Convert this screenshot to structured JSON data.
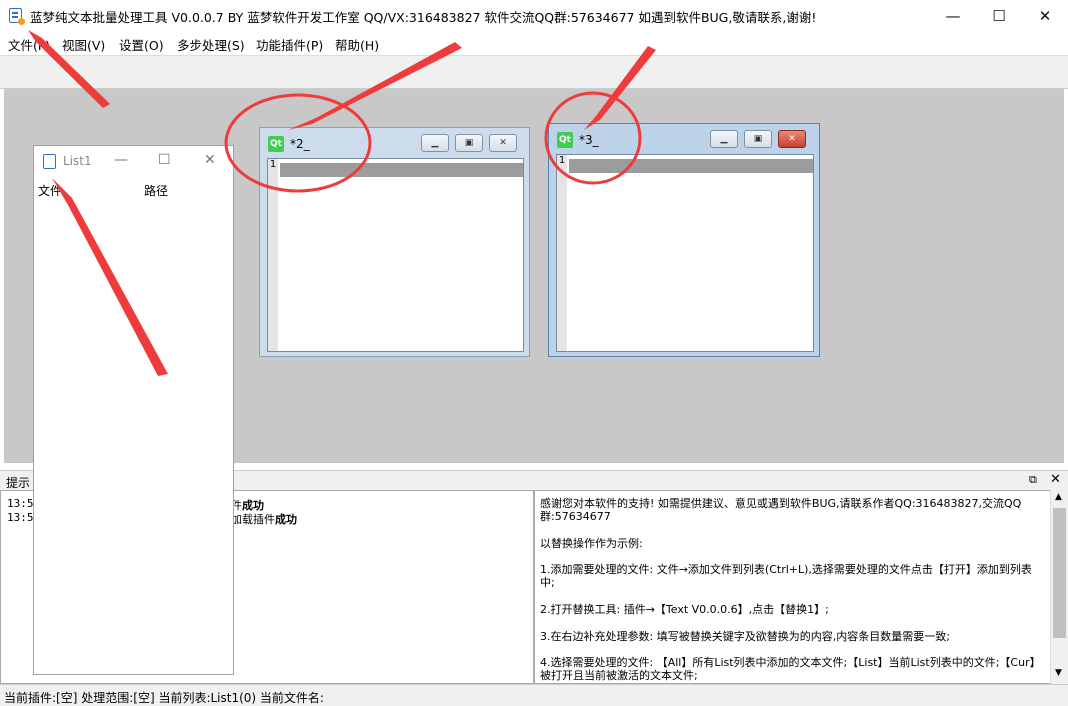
{
  "window": {
    "title": "蓝梦纯文本批量处理工具 V0.0.0.7 BY 蓝梦软件开发工作室 QQ/VX:316483827 软件交流QQ群:57634677 如遇到软件BUG,敬请联系,谢谢!",
    "minimize": "—",
    "maximize": "☐",
    "close": "✕"
  },
  "menu": {
    "file": "文件(F)",
    "view": "视图(V)",
    "settings": "设置(O)",
    "multistep": "多步处理(S)",
    "plugins": "功能插件(P)",
    "help": "帮助(H)"
  },
  "subwindows": [
    {
      "title": "*2_",
      "line": "1"
    },
    {
      "title": "*3_",
      "line": "1"
    }
  ],
  "list_window": {
    "title": "List1",
    "col_file": "文件",
    "col_path": "路径",
    "min": "—",
    "max": "☐",
    "close": "✕"
  },
  "hint": {
    "label": "提示",
    "log": [
      {
        "time": "13:5",
        "msg_prefix": "件",
        "msg_bold": "成功"
      },
      {
        "time": "13:5",
        "msg_prefix": "加载插件",
        "msg_bold": "成功"
      }
    ],
    "help": {
      "p1": "感谢您对本软件的支持! 如需提供建议、意见或遇到软件BUG,请联系作者QQ:316483827,交流QQ群:57634677",
      "p2": "以替换操作作为示例:",
      "p3": "1.添加需要处理的文件: 文件→添加文件到列表(Ctrl+L),选择需要处理的文件点击【打开】添加到列表中;",
      "p4": "2.打开替换工具: 插件→【Text V0.0.0.6】,点击【替换1】;",
      "p5": "3.在右边补充处理参数: 填写被替换关键字及欲替换为的内容,内容条目数量需要一致;",
      "p6": "4.选择需要处理的文件: 【All】所有List列表中添加的文本文件;【List】当前List列表中的文件;【Cur】被打开且当前被激活的文本文件;"
    }
  },
  "status": {
    "text": "当前插件:[空] 处理范围:[空] 当前列表:List1(0) 当前文件名:"
  },
  "colors": {
    "annotation": "#ee3b3b",
    "qt_green": "#41cd52"
  }
}
